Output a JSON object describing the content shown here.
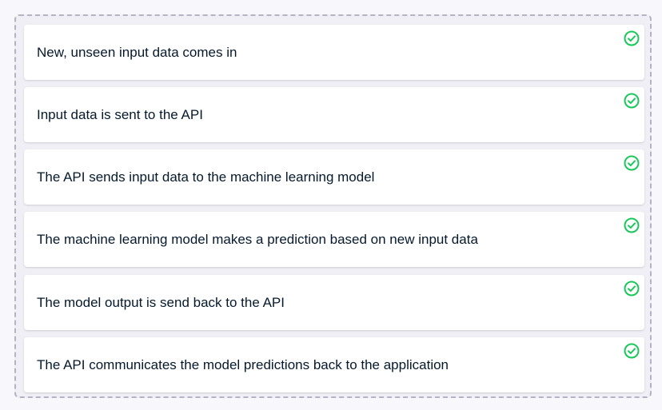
{
  "steps": [
    {
      "label": "New, unseen input data comes in",
      "status": "correct",
      "icon": "check-circle-icon"
    },
    {
      "label": "Input data is sent to the API",
      "status": "correct",
      "icon": "check-circle-icon"
    },
    {
      "label": "The API sends input data to the machine learning model",
      "status": "correct",
      "icon": "check-circle-icon"
    },
    {
      "label": "The machine learning model makes a prediction based on new input data",
      "status": "correct",
      "icon": "check-circle-icon"
    },
    {
      "label": "The model output is send back to the API",
      "status": "correct",
      "icon": "check-circle-icon"
    },
    {
      "label": "The API communicates the model predictions back to the application",
      "status": "correct",
      "icon": "check-circle-icon"
    }
  ],
  "colors": {
    "check": "#03ef62",
    "text": "#05192d",
    "dropzone_border": "#b6b2c6",
    "dropzone_bg": "#efeff5"
  }
}
